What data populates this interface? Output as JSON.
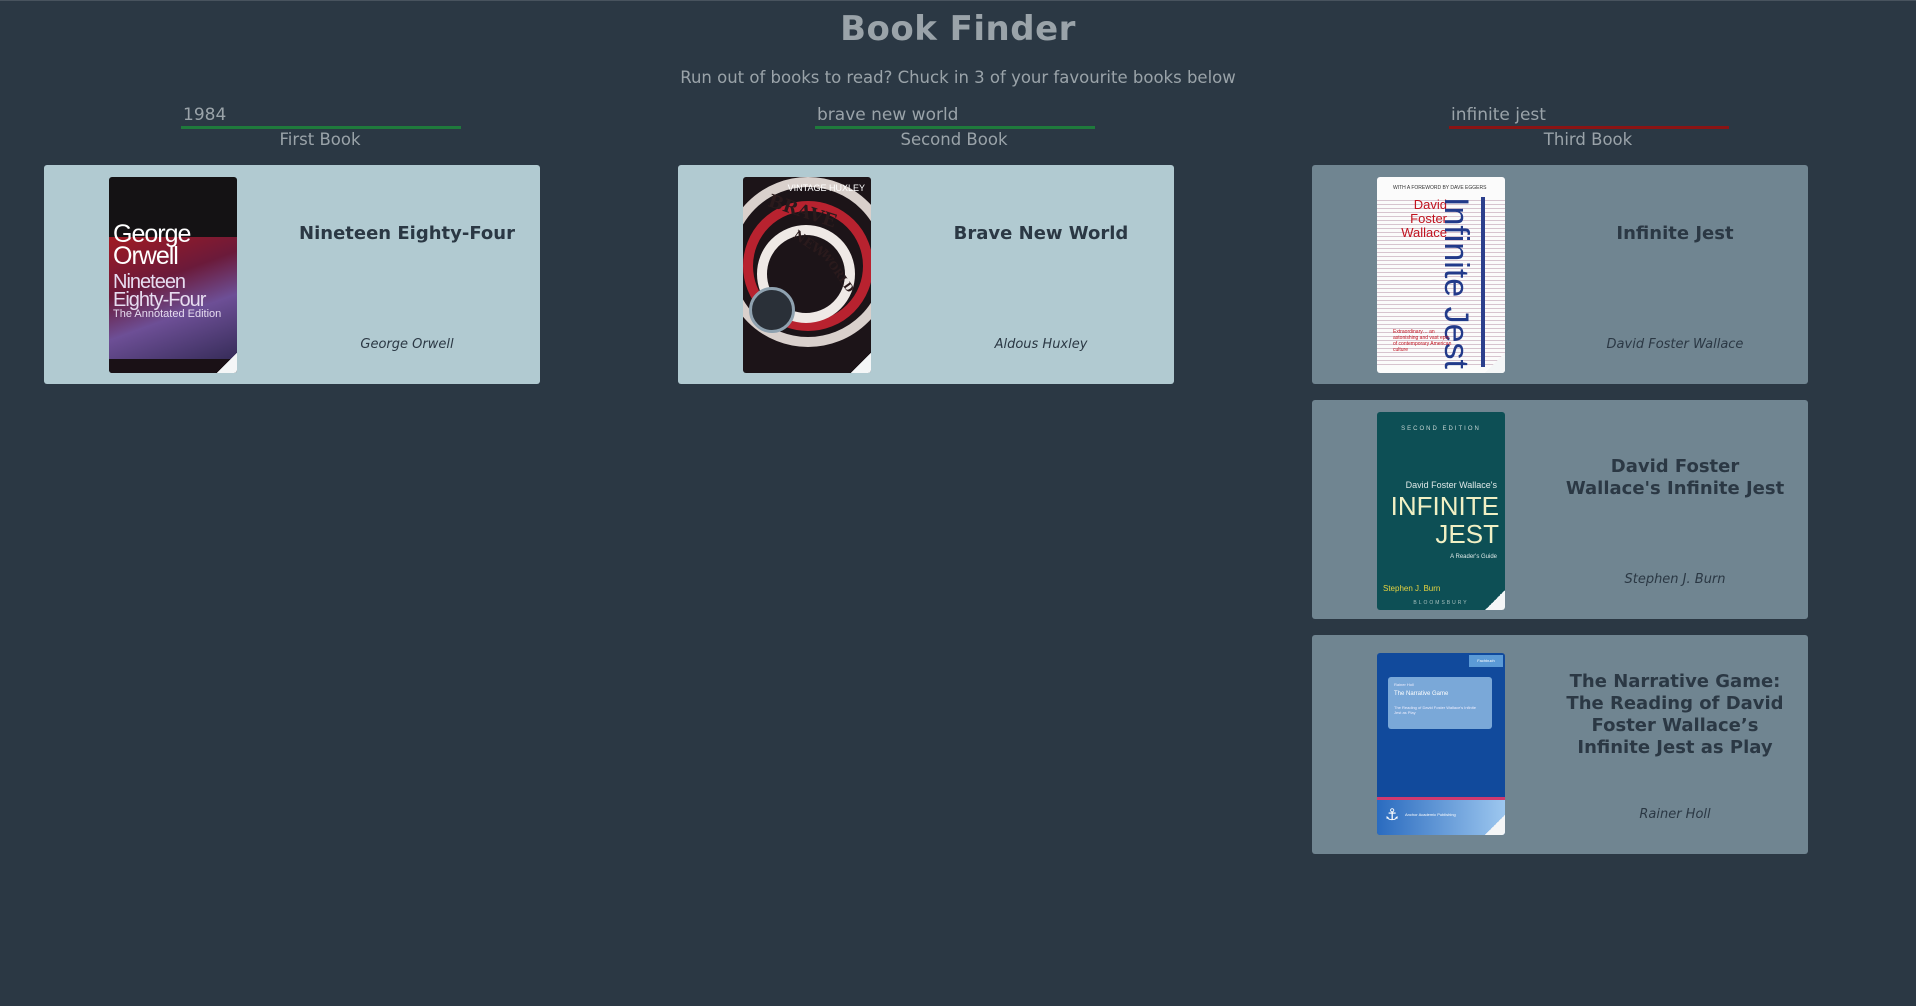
{
  "header": {
    "title": "Book Finder",
    "subtitle": "Run out of books to read? Chuck in 3 of your favourite books below"
  },
  "columns": [
    {
      "search_value": "1984",
      "label": "First Book",
      "status_color": "#1f7a3c",
      "results": [
        {
          "title": "Nineteen Eighty-Four",
          "author": "George Orwell",
          "cover": {
            "line1": "George Orwell",
            "line2": "Nineteen Eighty-Four",
            "line3": "The Annotated Edition"
          }
        }
      ]
    },
    {
      "search_value": "brave new world",
      "label": "Second Book",
      "status_color": "#1f7a3c",
      "results": [
        {
          "title": "Brave New World",
          "author": "Aldous Huxley",
          "cover": {
            "header": "VINTAGE HUXLEY",
            "w1": "BRAVE",
            "w2": "NEW",
            "w3": "WORLD"
          }
        }
      ]
    },
    {
      "search_value": "infinite jest",
      "label": "Third Book",
      "status_color": "#8b1414",
      "results": [
        {
          "title": "Infinite Jest",
          "author": "David Foster Wallace",
          "cover": {
            "foreword": "WITH A FOREWORD BY DAVE EGGERS",
            "name": "David Foster Wallace",
            "big": "Infinite Jest",
            "blurb": "Extraordinary… an astonishing and vast epic of contemporary American culture"
          }
        },
        {
          "title": "David Foster Wallace's Infinite Jest",
          "author": "Stephen J. Burn",
          "cover": {
            "edition": "SECOND EDITION",
            "by": "David Foster Wallace's",
            "big": "INFINITE JEST",
            "sub": "A Reader's Guide",
            "author": "Stephen J. Burn",
            "publisher": "BLOOMSBURY"
          }
        },
        {
          "title": "The Narrative Game: The Reading of David Foster Wallace’s Infinite Jest as Play",
          "author": "Rainer Holl",
          "cover": {
            "tag": "Fachbuch",
            "author": "Rainer Holl",
            "title": "The Narrative Game",
            "subtitle": "The Reading of David Foster Wallace's Infinite Jest as Play",
            "publisher": "Anchor Academic Publishing"
          }
        }
      ]
    }
  ],
  "colors": {
    "background": "#2b3844",
    "card_active": "#b1cad1",
    "card_inactive": "#708591",
    "valid_underline": "#1f7a3c",
    "invalid_underline": "#8b1414"
  }
}
